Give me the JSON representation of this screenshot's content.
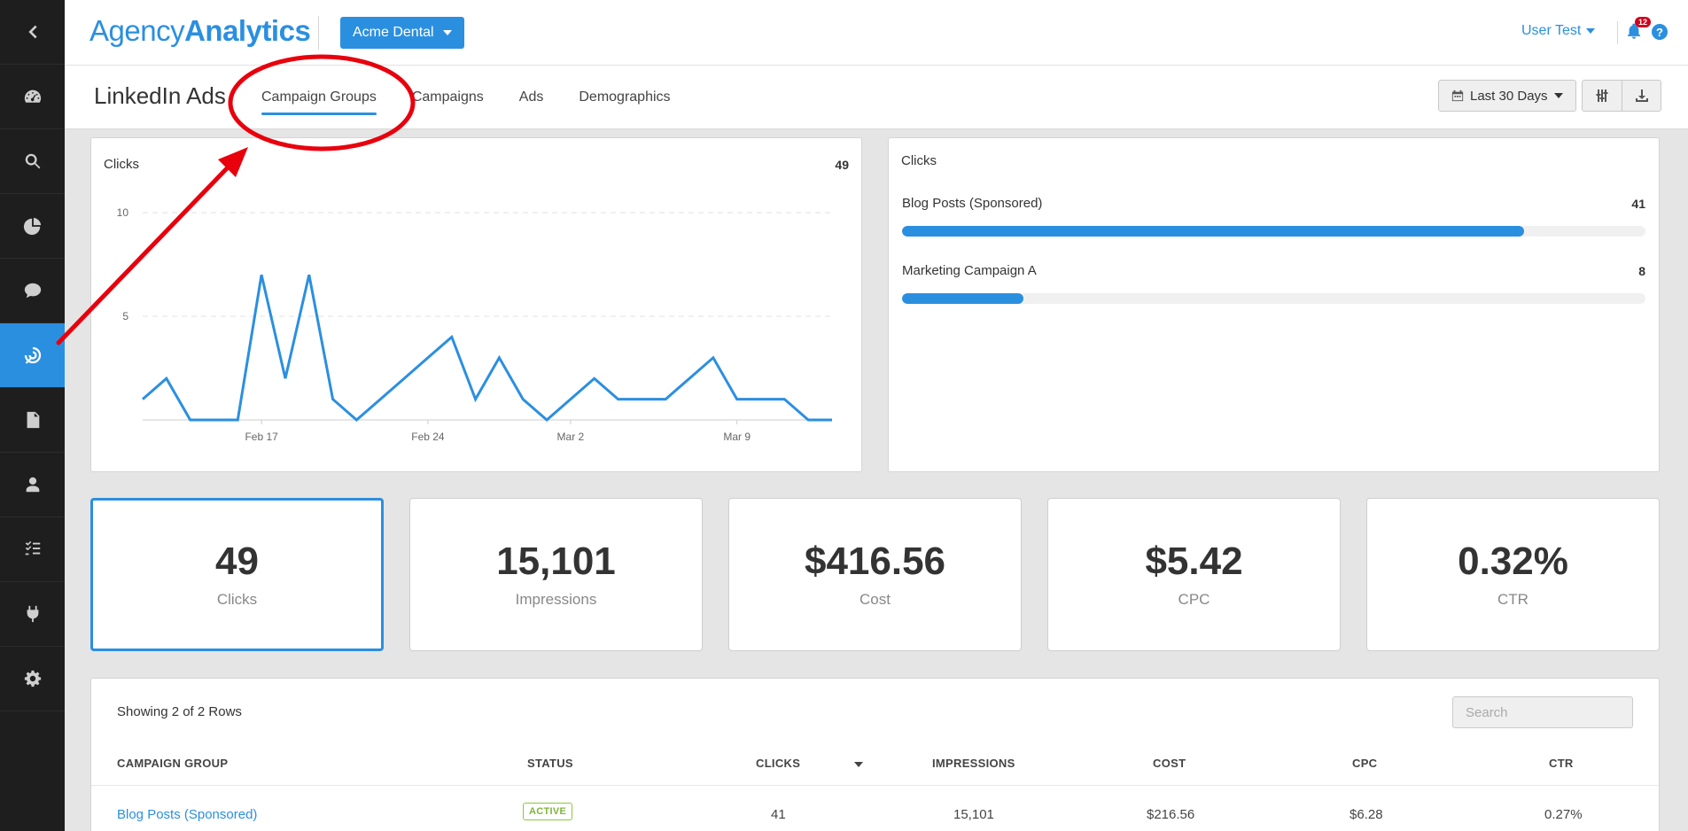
{
  "brand": {
    "part1": "Agency",
    "part2": "Analytics",
    "accent": "#2b8fe0"
  },
  "client": {
    "name": "Acme Dental"
  },
  "user": {
    "name": "User Test",
    "notifications": "12"
  },
  "sidebar": {
    "items": [
      {
        "icon": "back-chevron-icon"
      },
      {
        "icon": "dashboard-gauge-icon"
      },
      {
        "icon": "search-icon"
      },
      {
        "icon": "pie-chart-icon"
      },
      {
        "icon": "chat-bubble-icon"
      },
      {
        "icon": "target-icon",
        "active": true
      },
      {
        "icon": "report-file-icon"
      },
      {
        "icon": "user-icon"
      },
      {
        "icon": "task-list-icon"
      },
      {
        "icon": "plug-icon"
      },
      {
        "icon": "gear-icon"
      }
    ]
  },
  "page": {
    "title": "LinkedIn Ads"
  },
  "tabs": [
    {
      "label": "Campaign Groups",
      "active": true
    },
    {
      "label": "Campaigns"
    },
    {
      "label": "Ads"
    },
    {
      "label": "Demographics"
    }
  ],
  "toolbar": {
    "date_range": "Last 30 Days"
  },
  "clicks_chart": {
    "title": "Clicks",
    "total": "49",
    "chart_data": {
      "type": "line",
      "title": "Clicks",
      "x": [
        "Feb 12",
        "Feb 13",
        "Feb 14",
        "Feb 15",
        "Feb 16",
        "Feb 17",
        "Feb 18",
        "Feb 19",
        "Feb 20",
        "Feb 21",
        "Feb 22",
        "Feb 23",
        "Feb 24",
        "Feb 25",
        "Feb 26",
        "Feb 27",
        "Feb 28",
        "Mar 1",
        "Mar 2",
        "Mar 3",
        "Mar 4",
        "Mar 5",
        "Mar 6",
        "Mar 7",
        "Mar 8",
        "Mar 9",
        "Mar 10",
        "Mar 11",
        "Mar 12",
        "Mar 13"
      ],
      "series": [
        {
          "values": [
            1,
            2,
            0,
            0,
            0,
            7,
            2,
            7,
            1,
            0,
            1,
            2,
            3,
            4,
            1,
            3,
            1,
            0,
            1,
            2,
            1,
            1,
            1,
            2,
            3,
            1,
            1,
            1,
            0,
            0
          ]
        }
      ],
      "xticks": [
        "Feb 17",
        "Feb 24",
        "Mar 2",
        "Mar 9"
      ],
      "yticks": [
        5,
        10
      ],
      "ylim": [
        0,
        10
      ],
      "grid": "horizontal-dashed",
      "color": "#2b8fe0"
    }
  },
  "clicks_breakdown": {
    "title": "Clicks",
    "chart_data": {
      "type": "bar",
      "orientation": "horizontal",
      "categories": [
        "Blog Posts (Sponsored)",
        "Marketing Campaign A"
      ],
      "values": [
        41,
        8
      ],
      "max": 49
    },
    "rows": [
      {
        "label": "Blog Posts (Sponsored)",
        "value": "41"
      },
      {
        "label": "Marketing Campaign A",
        "value": "8"
      }
    ]
  },
  "kpis": [
    {
      "value": "49",
      "label": "Clicks"
    },
    {
      "value": "15,101",
      "label": "Impressions"
    },
    {
      "value": "$416.56",
      "label": "Cost"
    },
    {
      "value": "$5.42",
      "label": "CPC"
    },
    {
      "value": "0.32%",
      "label": "CTR"
    }
  ],
  "table": {
    "showing": "Showing 2 of 2 Rows",
    "search_placeholder": "Search",
    "headers": [
      "CAMPAIGN GROUP",
      "STATUS",
      "CLICKS",
      "IMPRESSIONS",
      "COST",
      "CPC",
      "CTR"
    ],
    "rows": [
      {
        "name": "Blog Posts (Sponsored)",
        "status": "ACTIVE",
        "clicks": "41",
        "impressions": "15,101",
        "cost": "$216.56",
        "cpc": "$6.28",
        "ctr": "0.27%"
      }
    ]
  },
  "annotation": {
    "color": "#e8000d"
  }
}
